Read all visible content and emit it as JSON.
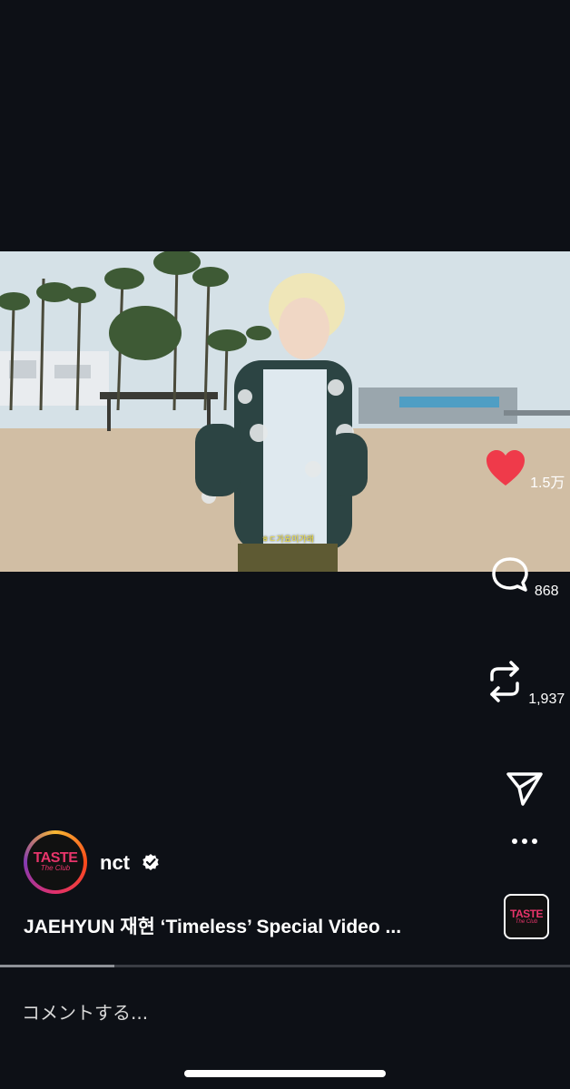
{
  "post": {
    "username": "nct",
    "verified": true,
    "caption": "JAEHYUN 재현 ‘Timeless’ Special Video ...",
    "avatar_text": "TASTE",
    "avatar_subtext": "The Club",
    "subtitle": "ㅎㄷ가요이가래"
  },
  "actions": {
    "likes": "1.5万",
    "comments": "868",
    "reposts": "1,937",
    "like_color": "#ef3a4a"
  },
  "playback": {
    "progress": 0.2
  },
  "comment_box": {
    "placeholder": "コメントする..."
  },
  "icons": [
    "heart-icon",
    "comment-icon",
    "repost-icon",
    "share-icon",
    "more-icon",
    "verified-icon"
  ]
}
